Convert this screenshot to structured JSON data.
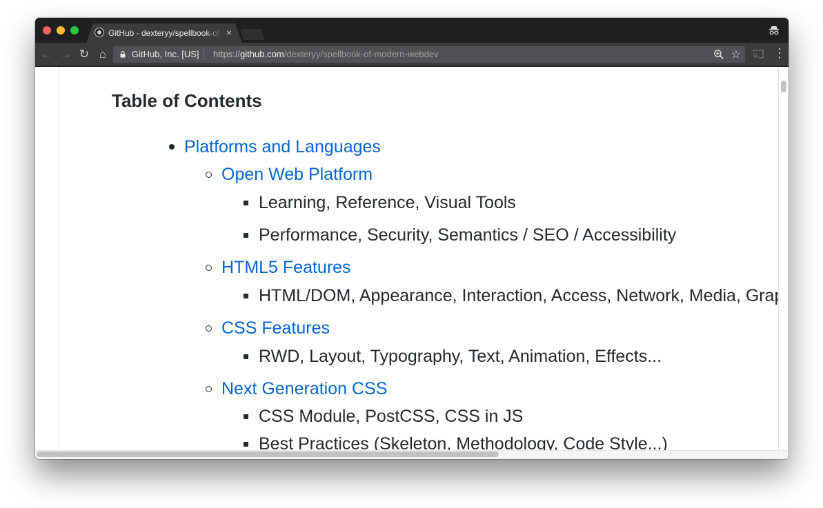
{
  "browser": {
    "tab": {
      "title": "GitHub - dexteryy/spellbook-of-modern-webdev",
      "close_glyph": "×"
    },
    "toolbar": {
      "back_glyph": "←",
      "forward_glyph": "→",
      "reload_glyph": "↻",
      "home_glyph": "⌂",
      "cert_label": "GitHub, Inc. [US]",
      "url_scheme": "https://",
      "url_host": "github.com",
      "url_path": "/dexteryy/spellbook-of-modern-webdev",
      "star_glyph": "☆",
      "menu_glyph": "⋮"
    },
    "icons": [
      "github-favicon-icon",
      "incognito-icon",
      "lock-icon",
      "zoom-icon",
      "star-icon",
      "cast-icon",
      "menu-icon"
    ],
    "colors": {
      "link": "#0366d6",
      "text": "#24292e",
      "chrome_dark": "#1e1f21",
      "chrome_toolbar": "#3a3b3d"
    }
  },
  "page": {
    "toc_title": "Table of Contents",
    "items": [
      {
        "level": 1,
        "text": "Platforms and Languages",
        "link": true
      },
      {
        "level": 2,
        "text": "Open Web Platform",
        "link": true
      },
      {
        "level": 3,
        "text": "Learning, Reference, Visual Tools",
        "link": false
      },
      {
        "level": 3,
        "text": "Performance, Security, Semantics / SEO / Accessibility",
        "link": false
      },
      {
        "level": 2,
        "text": "HTML5 Features",
        "link": true
      },
      {
        "level": 3,
        "text": "HTML/DOM, Appearance, Interaction, Access, Network, Media, Graph",
        "link": false
      },
      {
        "level": 2,
        "text": "CSS Features",
        "link": true
      },
      {
        "level": 3,
        "text": "RWD, Layout, Typography, Text, Animation, Effects...",
        "link": false
      },
      {
        "level": 2,
        "text": "Next Generation CSS",
        "link": true
      },
      {
        "level": 3,
        "text": "CSS Module, PostCSS, CSS in JS",
        "link": false
      },
      {
        "level": 3,
        "text": "Best Practices (Skeleton, Methodology, Code Style...)",
        "link": false
      }
    ]
  }
}
